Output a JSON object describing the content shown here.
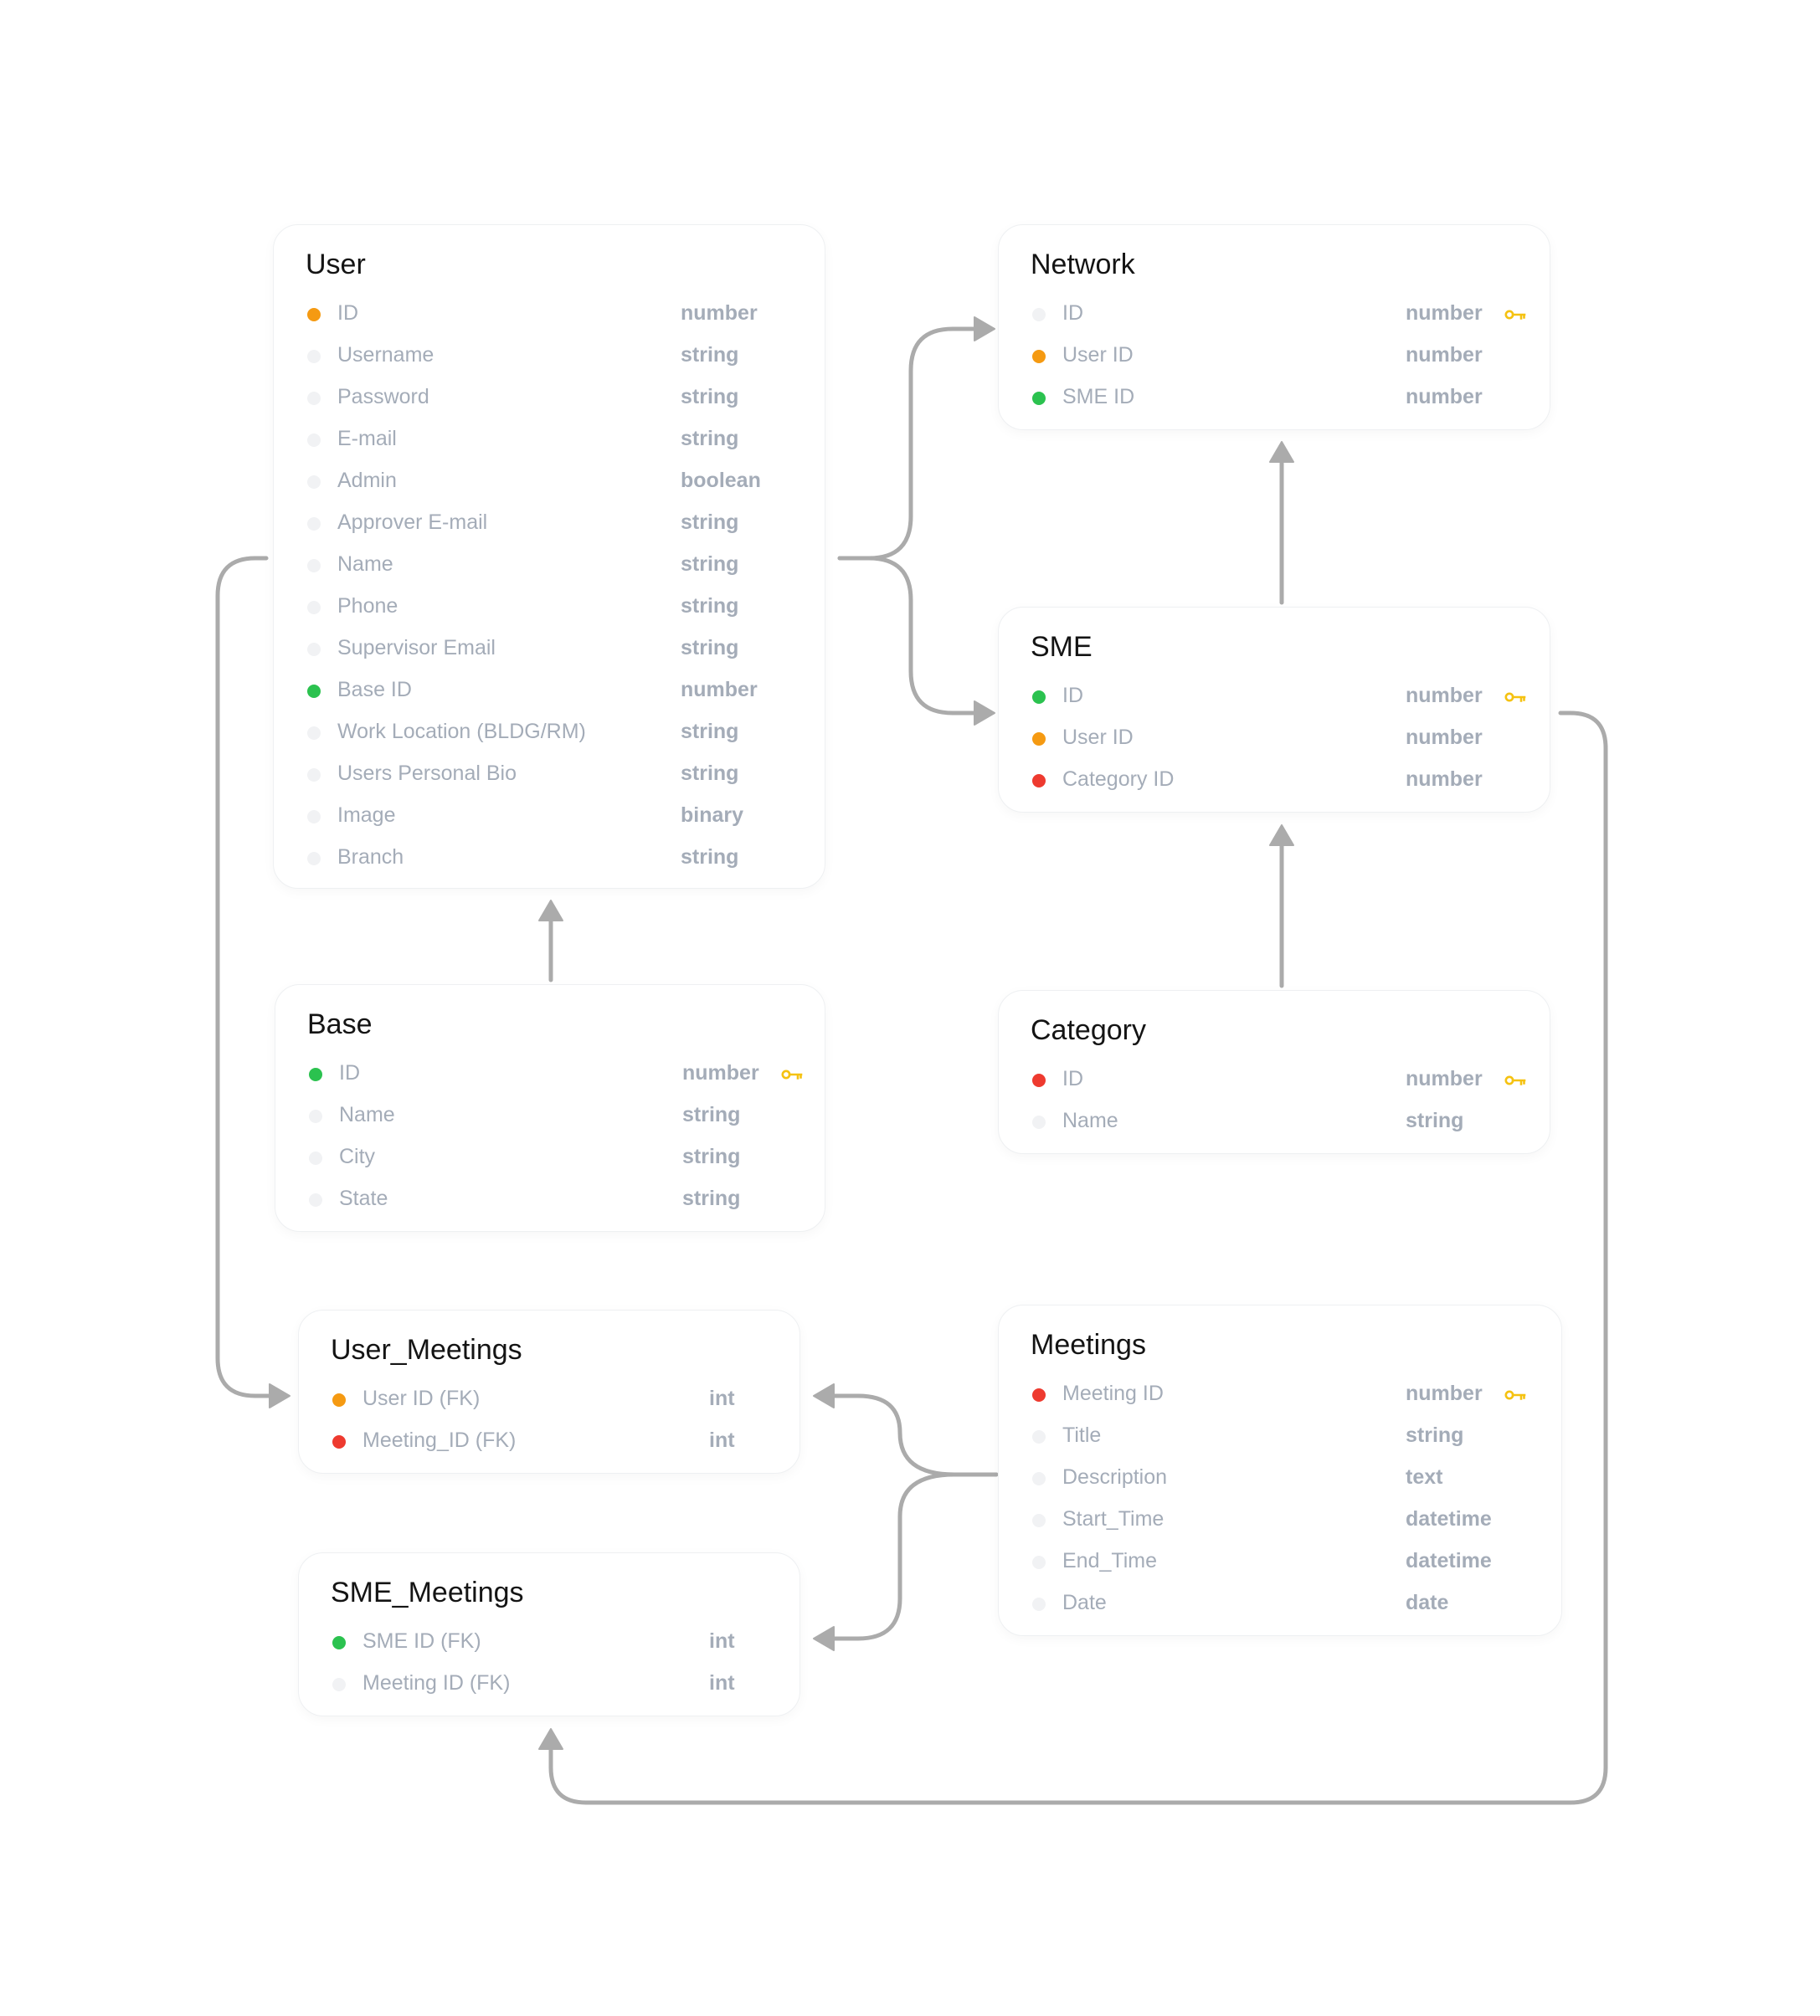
{
  "colors": {
    "background": "#ffffff",
    "connector": "#ababab",
    "key": "#f5c211",
    "dots": {
      "orange": "#f59a12",
      "green": "#2bc24f",
      "red": "#ee3a2f",
      "none": "#f1f2f4"
    }
  },
  "tables": [
    {
      "id": "user",
      "title": "User",
      "fields": [
        {
          "name": "ID",
          "type": "number",
          "dot": "orange",
          "key": false
        },
        {
          "name": "Username",
          "type": "string",
          "dot": "none",
          "key": false
        },
        {
          "name": "Password",
          "type": "string",
          "dot": "none",
          "key": false
        },
        {
          "name": "E-mail",
          "type": "string",
          "dot": "none",
          "key": false
        },
        {
          "name": "Admin",
          "type": "boolean",
          "dot": "none",
          "key": false
        },
        {
          "name": "Approver E-mail",
          "type": "string",
          "dot": "none",
          "key": false
        },
        {
          "name": "Name",
          "type": "string",
          "dot": "none",
          "key": false
        },
        {
          "name": "Phone",
          "type": "string",
          "dot": "none",
          "key": false
        },
        {
          "name": "Supervisor Email",
          "type": "string",
          "dot": "none",
          "key": false
        },
        {
          "name": "Base ID",
          "type": "number",
          "dot": "green",
          "key": false
        },
        {
          "name": "Work Location (BLDG/RM)",
          "type": "string",
          "dot": "none",
          "key": false
        },
        {
          "name": "Users Personal Bio",
          "type": "string",
          "dot": "none",
          "key": false
        },
        {
          "name": "Image",
          "type": "binary",
          "dot": "none",
          "key": false
        },
        {
          "name": "Branch",
          "type": "string",
          "dot": "none",
          "key": false
        }
      ]
    },
    {
      "id": "network",
      "title": "Network",
      "fields": [
        {
          "name": "ID",
          "type": "number",
          "dot": "none",
          "key": true
        },
        {
          "name": "User ID",
          "type": "number",
          "dot": "orange",
          "key": false
        },
        {
          "name": "SME ID",
          "type": "number",
          "dot": "green",
          "key": false
        }
      ]
    },
    {
      "id": "sme",
      "title": "SME",
      "fields": [
        {
          "name": "ID",
          "type": "number",
          "dot": "green",
          "key": true
        },
        {
          "name": "User ID",
          "type": "number",
          "dot": "orange",
          "key": false
        },
        {
          "name": "Category ID",
          "type": "number",
          "dot": "red",
          "key": false
        }
      ]
    },
    {
      "id": "base",
      "title": "Base",
      "fields": [
        {
          "name": "ID",
          "type": "number",
          "dot": "green",
          "key": true
        },
        {
          "name": "Name",
          "type": "string",
          "dot": "none",
          "key": false
        },
        {
          "name": "City",
          "type": "string",
          "dot": "none",
          "key": false
        },
        {
          "name": "State",
          "type": "string",
          "dot": "none",
          "key": false
        }
      ]
    },
    {
      "id": "category",
      "title": "Category",
      "fields": [
        {
          "name": "ID",
          "type": "number",
          "dot": "red",
          "key": true
        },
        {
          "name": "Name",
          "type": "string",
          "dot": "none",
          "key": false
        }
      ]
    },
    {
      "id": "user_meetings",
      "title": "User_Meetings",
      "fields": [
        {
          "name": "User ID (FK)",
          "type": "int",
          "dot": "orange",
          "key": false
        },
        {
          "name": "Meeting_ID (FK)",
          "type": "int",
          "dot": "red",
          "key": false
        }
      ]
    },
    {
      "id": "meetings",
      "title": "Meetings",
      "fields": [
        {
          "name": "Meeting ID",
          "type": "number",
          "dot": "red",
          "key": true
        },
        {
          "name": "Title",
          "type": "string",
          "dot": "none",
          "key": false
        },
        {
          "name": "Description",
          "type": "text",
          "dot": "none",
          "key": false
        },
        {
          "name": "Start_Time",
          "type": "datetime",
          "dot": "none",
          "key": false
        },
        {
          "name": "End_Time",
          "type": "datetime",
          "dot": "none",
          "key": false
        },
        {
          "name": "Date",
          "type": "date",
          "dot": "none",
          "key": false
        }
      ]
    },
    {
      "id": "sme_meetings",
      "title": "SME_Meetings",
      "fields": [
        {
          "name": "SME ID (FK)",
          "type": "int",
          "dot": "green",
          "key": false
        },
        {
          "name": "Meeting ID (FK)",
          "type": "int",
          "dot": "none",
          "key": false
        }
      ]
    }
  ],
  "relationships": [
    {
      "from": "user",
      "to": "network"
    },
    {
      "from": "user",
      "to": "sme"
    },
    {
      "from": "sme",
      "to": "network"
    },
    {
      "from": "category",
      "to": "sme"
    },
    {
      "from": "base",
      "to": "user"
    },
    {
      "from": "user",
      "to": "user_meetings"
    },
    {
      "from": "meetings",
      "to": "user_meetings"
    },
    {
      "from": "meetings",
      "to": "sme_meetings"
    },
    {
      "from": "sme",
      "to": "sme_meetings"
    }
  ]
}
